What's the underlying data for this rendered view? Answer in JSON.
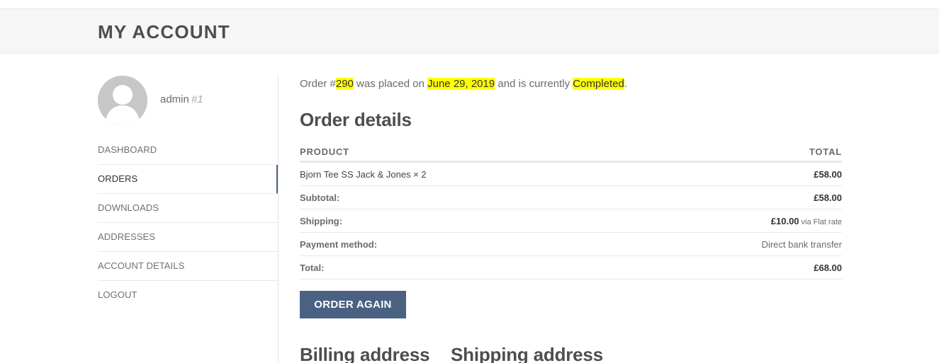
{
  "header": {
    "title": "MY ACCOUNT"
  },
  "user": {
    "name": "admin",
    "id_label": "#1"
  },
  "sidebar": {
    "items": [
      {
        "label": "DASHBOARD"
      },
      {
        "label": "ORDERS",
        "active": true
      },
      {
        "label": "DOWNLOADS"
      },
      {
        "label": "ADDRESSES"
      },
      {
        "label": "ACCOUNT DETAILS"
      },
      {
        "label": "LOGOUT"
      }
    ]
  },
  "notice": {
    "prefix": "Order #",
    "order_number": "290",
    "mid1": " was placed on ",
    "date": "June 29, 2019",
    "mid2": " and is currently ",
    "status": "Completed",
    "suffix": "."
  },
  "order_details": {
    "title": "Order details",
    "columns": {
      "product": "PRODUCT",
      "total": "TOTAL"
    },
    "item": {
      "name": "Bjorn Tee SS Jack & Jones × 2",
      "total": "£58.00"
    },
    "subtotal": {
      "label": "Subtotal:",
      "value": "£58.00"
    },
    "shipping": {
      "label": "Shipping:",
      "value": "£10.00",
      "note": "via Flat rate"
    },
    "payment": {
      "label": "Payment method:",
      "value": "Direct bank transfer"
    },
    "total": {
      "label": "Total:",
      "value": "£68.00"
    }
  },
  "actions": {
    "order_again": "ORDER AGAIN"
  },
  "addresses": {
    "billing_title": "Billing address",
    "shipping_title": "Shipping address"
  },
  "colors": {
    "accent": "#4a6182",
    "highlight": "#ffff00",
    "header_bg": "#f6f6f6"
  }
}
